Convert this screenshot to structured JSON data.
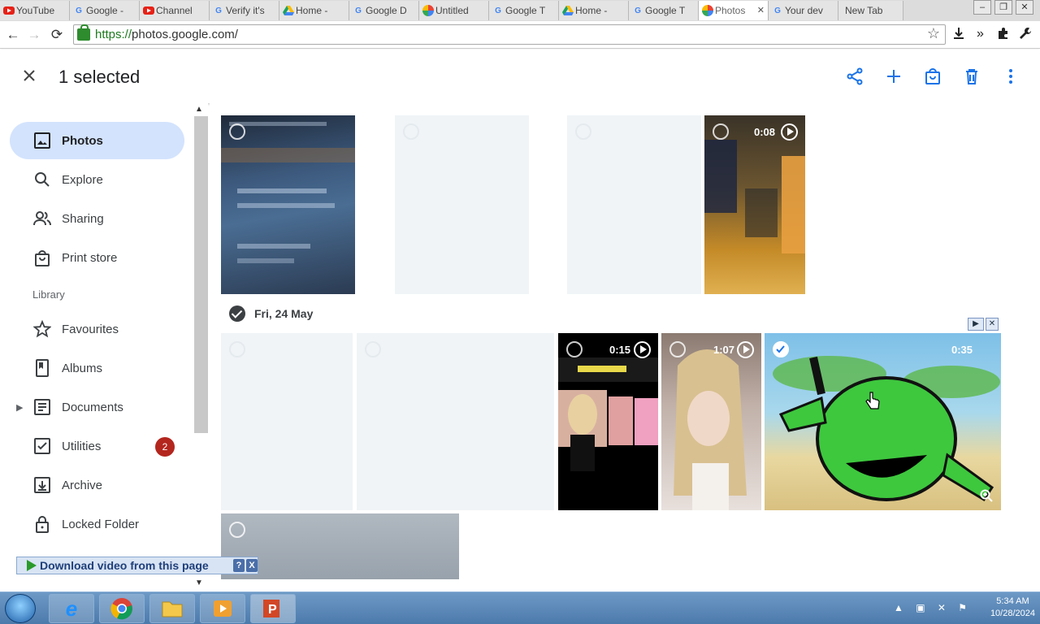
{
  "browser": {
    "tabs": [
      {
        "title": "YouTube",
        "icon": "youtube-icon",
        "color": "#e62117"
      },
      {
        "title": "Google -",
        "icon": "google-icon",
        "color": "#4285f4"
      },
      {
        "title": "Channel",
        "icon": "youtube-icon",
        "color": "#e62117"
      },
      {
        "title": "Verify it's",
        "icon": "google-icon",
        "color": "#4285f4"
      },
      {
        "title": "Home -",
        "icon": "drive-icon",
        "color": "#1aa260"
      },
      {
        "title": "Google D",
        "icon": "google-icon",
        "color": "#4285f4"
      },
      {
        "title": "Untitled",
        "icon": "photos-icon",
        "color": "#fbbc04"
      },
      {
        "title": "Google T",
        "icon": "google-icon",
        "color": "#4285f4"
      },
      {
        "title": "Home -",
        "icon": "drive-icon",
        "color": "#1aa260"
      },
      {
        "title": "Google T",
        "icon": "google-icon",
        "color": "#4285f4"
      },
      {
        "title": "Photos",
        "icon": "photos-icon",
        "color": "#fbbc04",
        "active": true
      },
      {
        "title": "Your dev",
        "icon": "google-icon",
        "color": "#4285f4"
      },
      {
        "title": "New Tab",
        "icon": "",
        "color": "#888888"
      }
    ],
    "url": {
      "scheme": "https://",
      "host": "photos.google.com",
      "path": "/"
    }
  },
  "appbar": {
    "title": "1 selected",
    "actions": [
      "share-icon",
      "add-icon",
      "shopping-bag-icon",
      "trash-icon",
      "more-vert-icon"
    ]
  },
  "sidebar": {
    "items": [
      {
        "label": "Photos",
        "icon": "photo-icon",
        "active": true
      },
      {
        "label": "Explore",
        "icon": "search-icon"
      },
      {
        "label": "Sharing",
        "icon": "people-icon"
      },
      {
        "label": "Print store",
        "icon": "shopping-bag-icon"
      }
    ],
    "library_header": "Library",
    "library": [
      {
        "label": "Favourites",
        "icon": "star-icon"
      },
      {
        "label": "Albums",
        "icon": "album-icon"
      },
      {
        "label": "Documents",
        "icon": "document-icon",
        "expandable": true
      },
      {
        "label": "Utilities",
        "icon": "utilities-icon",
        "badge": "2"
      },
      {
        "label": "Archive",
        "icon": "archive-icon"
      },
      {
        "label": "Locked Folder",
        "icon": "lock-icon"
      }
    ]
  },
  "grid": {
    "row1": [
      {
        "kind": "photo",
        "name": "photo-tile-screen"
      },
      {
        "kind": "placeholder"
      },
      {
        "kind": "placeholder"
      },
      {
        "kind": "video",
        "duration": "0:08"
      }
    ],
    "date_group": {
      "label": "Fri, 24 May",
      "selected": true
    },
    "row2": [
      {
        "kind": "placeholder"
      },
      {
        "kind": "placeholder"
      },
      {
        "kind": "video",
        "duration": "0:15"
      },
      {
        "kind": "video",
        "duration": "1:07"
      },
      {
        "kind": "video",
        "duration": "0:35",
        "selected": true
      }
    ]
  },
  "download_bar": {
    "label": "Download video from this page",
    "help": "?",
    "close": "X"
  },
  "taskbar": {
    "apps": [
      "ie-icon",
      "chrome-icon",
      "folder-icon",
      "media-player-icon",
      "powerpoint-icon"
    ],
    "time": "5:34 AM",
    "date": "10/28/2024"
  },
  "colors": {
    "accent": "#1a73e8",
    "nav_active": "#d3e3fd",
    "badge": "#b3261e"
  }
}
